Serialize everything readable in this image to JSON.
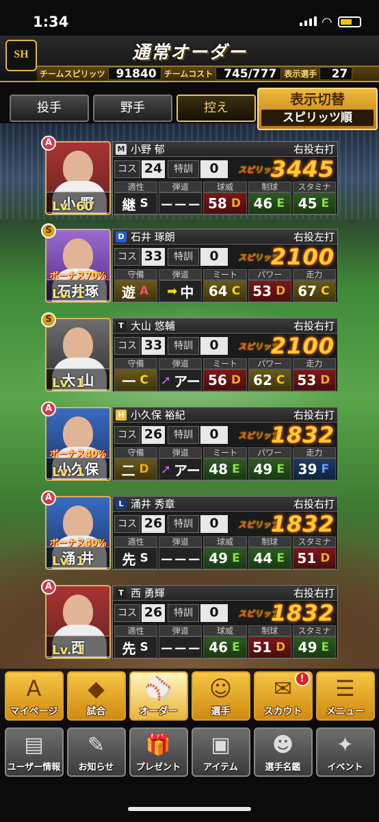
{
  "status": {
    "time": "1:34"
  },
  "header": {
    "logo_text": "SH",
    "title": "通常オーダー",
    "team_spirits_label": "チームスピリッツ",
    "team_spirits_value": "91840",
    "team_cost_label": "チームコスト",
    "team_cost_value": "745/777",
    "shown_players_label": "表示選手",
    "shown_players_value": "27"
  },
  "tabs": [
    "投手",
    "野手",
    "控え"
  ],
  "sort": {
    "label": "表示切替",
    "value": "スピリッツ順"
  },
  "cards": [
    {
      "rank": "A",
      "team_icon": "M",
      "name": "小野 郁",
      "portrait_name": "小 野",
      "level": "Lv. 60",
      "hand": "右投右打",
      "cost_label": "コス",
      "cost": "24",
      "train_label": "特訓",
      "train": "0",
      "spirits_label": "スピリッツ",
      "spirits": "3445",
      "bonus": "",
      "stats": [
        {
          "h": "適性",
          "v": "継",
          "g": "S"
        },
        {
          "h": "弾道",
          "v": "－－－",
          "g": ""
        },
        {
          "h": "球威",
          "v": "58",
          "g": "D"
        },
        {
          "h": "制球",
          "v": "46",
          "g": "E"
        },
        {
          "h": "スタミナ",
          "v": "45",
          "g": "E"
        }
      ]
    },
    {
      "rank": "S",
      "team_icon": "D",
      "name": "石井 琢朗",
      "portrait_name": "石井琢",
      "level": "Lv. 1",
      "hand": "右投左打",
      "cost_label": "コス",
      "cost": "33",
      "train_label": "特訓",
      "train": "0",
      "spirits_label": "スピリッツ",
      "spirits": "2100",
      "bonus": "ボーナス70%",
      "stats": [
        {
          "h": "守備",
          "v": "遊",
          "g": "A"
        },
        {
          "h": "弾道",
          "v": "中",
          "g": ""
        },
        {
          "h": "ミート",
          "v": "64",
          "g": "C"
        },
        {
          "h": "パワー",
          "v": "53",
          "g": "D"
        },
        {
          "h": "走力",
          "v": "67",
          "g": "C"
        }
      ]
    },
    {
      "rank": "S",
      "team_icon": "T",
      "name": "大山 悠輔",
      "portrait_name": "大 山",
      "level": "Lv. 1",
      "hand": "右投右打",
      "cost_label": "コス",
      "cost": "33",
      "train_label": "特訓",
      "train": "0",
      "spirits_label": "スピリッツ",
      "spirits": "2100",
      "bonus": "",
      "stats": [
        {
          "h": "守備",
          "v": "一",
          "g": "C"
        },
        {
          "h": "弾道",
          "v": "アー",
          "g": ""
        },
        {
          "h": "ミート",
          "v": "56",
          "g": "D"
        },
        {
          "h": "パワー",
          "v": "62",
          "g": "C"
        },
        {
          "h": "走力",
          "v": "53",
          "g": "D"
        }
      ]
    },
    {
      "rank": "A",
      "team_icon": "H",
      "name": "小久保 裕紀",
      "portrait_name": "小久保",
      "level": "Lv. 1",
      "hand": "右投右打",
      "cost_label": "コス",
      "cost": "26",
      "train_label": "特訓",
      "train": "0",
      "spirits_label": "スピリッツ",
      "spirits": "1832",
      "bonus": "ボーナス40%",
      "stats": [
        {
          "h": "守備",
          "v": "二",
          "g": "D"
        },
        {
          "h": "弾道",
          "v": "アー",
          "g": ""
        },
        {
          "h": "ミート",
          "v": "48",
          "g": "E"
        },
        {
          "h": "パワー",
          "v": "49",
          "g": "E"
        },
        {
          "h": "走力",
          "v": "39",
          "g": "F"
        }
      ]
    },
    {
      "rank": "A",
      "team_icon": "L",
      "name": "涌井 秀章",
      "portrait_name": "涌 井",
      "level": "Lv. 1",
      "hand": "右投右打",
      "cost_label": "コス",
      "cost": "26",
      "train_label": "特訓",
      "train": "0",
      "spirits_label": "スピリッツ",
      "spirits": "1832",
      "bonus": "ボーナス40%",
      "stats": [
        {
          "h": "適性",
          "v": "先",
          "g": "S"
        },
        {
          "h": "弾道",
          "v": "－－－",
          "g": ""
        },
        {
          "h": "球威",
          "v": "49",
          "g": "E"
        },
        {
          "h": "制球",
          "v": "44",
          "g": "E"
        },
        {
          "h": "スタミナ",
          "v": "51",
          "g": "D"
        }
      ]
    },
    {
      "rank": "A",
      "team_icon": "T",
      "name": "西 勇輝",
      "portrait_name": "西",
      "level": "Lv. 1",
      "hand": "右投右打",
      "cost_label": "コス",
      "cost": "26",
      "train_label": "特訓",
      "train": "0",
      "spirits_label": "スピリッツ",
      "spirits": "1832",
      "bonus": "",
      "stats": [
        {
          "h": "適性",
          "v": "先",
          "g": "S"
        },
        {
          "h": "弾道",
          "v": "－－－",
          "g": ""
        },
        {
          "h": "球威",
          "v": "46",
          "g": "E"
        },
        {
          "h": "制球",
          "v": "51",
          "g": "D"
        },
        {
          "h": "スタミナ",
          "v": "49",
          "g": "E"
        }
      ]
    }
  ],
  "nav_main": [
    {
      "label": "マイページ",
      "icon": "A"
    },
    {
      "label": "試合",
      "icon": "◆"
    },
    {
      "label": "オーダー",
      "icon": "⚾"
    },
    {
      "label": "選手",
      "icon": "☺"
    },
    {
      "label": "スカウト",
      "icon": "✉",
      "badge": "!"
    },
    {
      "label": "メニュー",
      "icon": "☰"
    }
  ],
  "nav_sub": [
    {
      "label": "ユーザー情報",
      "icon": "▤"
    },
    {
      "label": "お知らせ",
      "icon": "✎"
    },
    {
      "label": "プレゼント",
      "icon": "🎁"
    },
    {
      "label": "アイテム",
      "icon": "▣"
    },
    {
      "label": "選手名鑑",
      "icon": "☻"
    },
    {
      "label": "イベント",
      "icon": "✦"
    }
  ]
}
